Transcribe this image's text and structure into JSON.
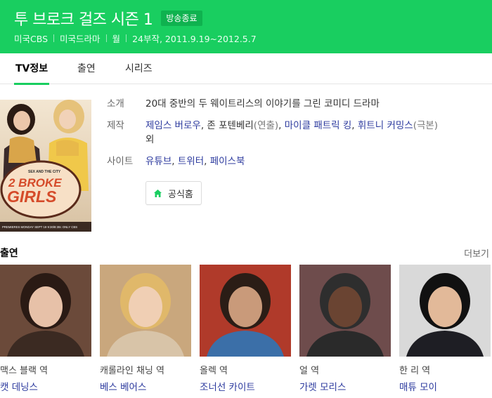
{
  "header": {
    "title": "투 브로크 걸즈 시즌 1",
    "badge": "방송종료",
    "meta": [
      "미국CBS",
      "미국드라마",
      "월",
      "24부작, 2011.9.19~2012.5.7"
    ]
  },
  "tabs": [
    {
      "label": "TV정보",
      "active": true
    },
    {
      "label": "출연",
      "active": false
    },
    {
      "label": "시리즈",
      "active": false
    }
  ],
  "info": {
    "intro_label": "소개",
    "intro_value": "20대 중반의 두 웨이트리스의 이야기를 그린 코미디 드라마",
    "prod_label": "제작",
    "prod_person1": "제임스 버로우",
    "prod_sep1": ", 존 포텐베리",
    "prod_role1": "(연출)",
    "prod_sep2": ", ",
    "prod_person2": "마이클 패트릭 킹",
    "prod_sep3": ", ",
    "prod_person3": "휘트니 커밍스",
    "prod_role2": "(극본)",
    "prod_etc": "외",
    "site_label": "사이트",
    "site_youtube": "유튜브",
    "site_sep1": ", ",
    "site_twitter": "트위터",
    "site_sep2": ", ",
    "site_facebook": "페이스북",
    "home_button": "공식홈"
  },
  "poster": {
    "tagline": "SEX AND THE CITY",
    "logo_line1": "2 BROKE",
    "logo_line2": "GIRLS",
    "footer": "PREMIERES MONDAY SEPT 19 9:30/8:30c ONLY CBS"
  },
  "cast": {
    "title": "출연",
    "more": "더보기",
    "members": [
      {
        "role": "맥스 블랙 역",
        "name": "캣 데닝스",
        "bg": "#6b4a3a",
        "hair": "#2a1a14",
        "skin": "#e7c1a8",
        "shirt": "#3b2a22"
      },
      {
        "role": "캐롤라인 채닝 역",
        "name": "베스 베어스",
        "bg": "#c9a77d",
        "hair": "#e0b86a",
        "skin": "#f0cfb4",
        "shirt": "#d8c4a8"
      },
      {
        "role": "올렉 역",
        "name": "조너선 카이트",
        "bg": "#b03a2a",
        "hair": "#2b1d16",
        "skin": "#c99a7a",
        "shirt": "#3b6fa8"
      },
      {
        "role": "얼 역",
        "name": "가렛 모리스",
        "bg": "#6e4c4c",
        "hair": "#2e2e2e",
        "skin": "#6a4432",
        "shirt": "#2a2a2a"
      },
      {
        "role": "한 리 역",
        "name": "매튜 모이",
        "bg": "#d9d9d9",
        "hair": "#111111",
        "skin": "#e2b999",
        "shirt": "#1e1e24"
      }
    ]
  },
  "colors": {
    "brand": "#19ce60",
    "link": "#2c3a9e"
  }
}
